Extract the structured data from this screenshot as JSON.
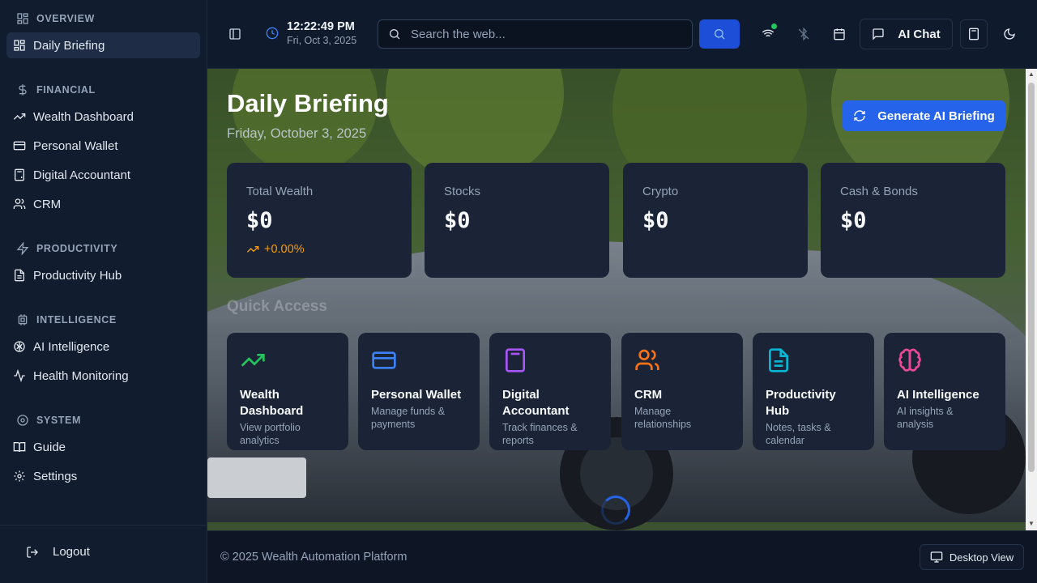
{
  "sidebar": {
    "sections": [
      {
        "title": "OVERVIEW",
        "icon": "layout-grid-icon"
      },
      {
        "title": "FINANCIAL",
        "icon": "dollar-icon"
      },
      {
        "title": "PRODUCTIVITY",
        "icon": "zap-icon"
      },
      {
        "title": "INTELLIGENCE",
        "icon": "cpu-icon"
      },
      {
        "title": "SYSTEM",
        "icon": "system-icon"
      }
    ],
    "items": [
      {
        "label": "Daily Briefing",
        "icon": "layout-grid-icon",
        "active": true
      },
      {
        "label": "Wealth Dashboard",
        "icon": "trending-up-icon"
      },
      {
        "label": "Personal Wallet",
        "icon": "credit-card-icon"
      },
      {
        "label": "Digital Accountant",
        "icon": "calculator-icon"
      },
      {
        "label": "CRM",
        "icon": "users-icon"
      },
      {
        "label": "Productivity Hub",
        "icon": "file-text-icon"
      },
      {
        "label": "AI Intelligence",
        "icon": "brain-icon"
      },
      {
        "label": "Health Monitoring",
        "icon": "activity-icon"
      },
      {
        "label": "Guide",
        "icon": "book-icon"
      },
      {
        "label": "Settings",
        "icon": "gear-icon"
      }
    ],
    "logout_label": "Logout"
  },
  "topbar": {
    "time": "12:22:49 PM",
    "date": "Fri, Oct 3, 2025",
    "search_placeholder": "Search the web...",
    "ai_chat_label": "AI Chat"
  },
  "main": {
    "title": "Daily Briefing",
    "subtitle": "Friday, October 3, 2025",
    "generate_label": "Generate AI Briefing",
    "stats": [
      {
        "label": "Total Wealth",
        "value": "$0",
        "change": "+0.00%"
      },
      {
        "label": "Stocks",
        "value": "$0"
      },
      {
        "label": "Crypto",
        "value": "$0"
      },
      {
        "label": "Cash & Bonds",
        "value": "$0"
      }
    ],
    "quick_access_title": "Quick Access",
    "quick": [
      {
        "title": "Wealth Dashboard",
        "desc": "View portfolio analytics",
        "icon": "trending-up-icon",
        "color": "#22c55e"
      },
      {
        "title": "Personal Wallet",
        "desc": "Manage funds & payments",
        "icon": "credit-card-icon",
        "color": "#3b82f6"
      },
      {
        "title": "Digital Accountant",
        "desc": "Track finances & reports",
        "icon": "calculator-icon",
        "color": "#a855f7"
      },
      {
        "title": "CRM",
        "desc": "Manage relationships",
        "icon": "users-icon",
        "color": "#f97316"
      },
      {
        "title": "Productivity Hub",
        "desc": "Notes, tasks & calendar",
        "icon": "file-text-icon",
        "color": "#06b6d4"
      },
      {
        "title": "AI Intelligence",
        "desc": "AI insights & analysis",
        "icon": "brain-icon",
        "color": "#ec4899"
      }
    ]
  },
  "footer": {
    "copyright": "© 2025 Wealth Automation Platform",
    "view_label": "Desktop View"
  },
  "colors": {
    "accent": "#2563eb",
    "positive": "#f59e0b",
    "status_online": "#22c55e"
  }
}
